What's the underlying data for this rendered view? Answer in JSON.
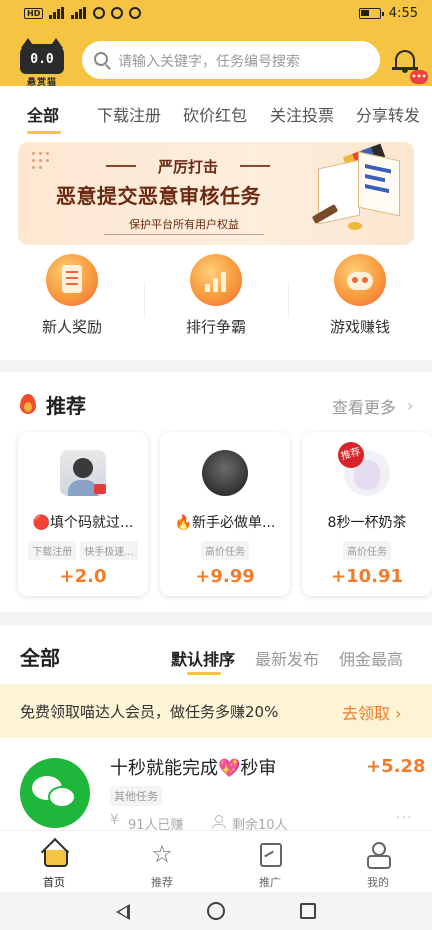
{
  "status_bar": {
    "network_left": "HD",
    "time": "4:55"
  },
  "header": {
    "logo_eyes": "0.0",
    "logo_text": "悬赏猫",
    "search_placeholder": "请输入关键字，任务编号搜索",
    "notification_badge": "•••"
  },
  "category_tabs": [
    {
      "label": "全部",
      "active": true
    },
    {
      "label": "下载注册",
      "active": false
    },
    {
      "label": "砍价红包",
      "active": false
    },
    {
      "label": "关注投票",
      "active": false
    },
    {
      "label": "分享转发",
      "active": false
    }
  ],
  "banner": {
    "kicker": "严厉打击",
    "headline": "恶意提交恶意审核任务",
    "sub": "保护平台所有用户权益"
  },
  "quick_links": [
    {
      "label": "新人奖励",
      "icon": "document-icon"
    },
    {
      "label": "排行争霸",
      "icon": "ranking-chart-icon"
    },
    {
      "label": "游戏赚钱",
      "icon": "gamepad-icon"
    }
  ],
  "recommend": {
    "title": "推荐",
    "more": "查看更多",
    "cards": [
      {
        "title": "🔴填个码就过...",
        "chips": [
          "下载注册",
          "快手极速..."
        ],
        "price": "+2.0"
      },
      {
        "title": "🔥新手必做单...",
        "chips": [
          "高价任务"
        ],
        "price": "+9.99"
      },
      {
        "title": "8秒一杯奶茶",
        "chips": [
          "高价任务"
        ],
        "price": "+10.91",
        "stamp": "推荐"
      }
    ]
  },
  "all_section": {
    "title": "全部",
    "sorts": [
      {
        "label": "默认排序",
        "active": true
      },
      {
        "label": "最新发布",
        "active": false
      },
      {
        "label": "佣金最高",
        "active": false
      }
    ],
    "promo_text": "免费领取喵达人会员，做任务多赚20%",
    "promo_cta": "去领取 ›",
    "task": {
      "title": "十秒就能完成💖秒审",
      "price": "+5.28",
      "chip": "其他任务",
      "earned": "91人已赚",
      "remaining": "剩余10人",
      "more": "···"
    }
  },
  "bottom_nav": [
    {
      "label": "首页",
      "active": true
    },
    {
      "label": "推荐",
      "active": false
    },
    {
      "label": "推广",
      "active": false
    },
    {
      "label": "我的",
      "active": false
    }
  ],
  "colors": {
    "brand_yellow": "#f6c443",
    "price_orange": "#f07d2c",
    "promo_bg": "#fdf3d5",
    "wechat_green": "#1fb73b"
  }
}
